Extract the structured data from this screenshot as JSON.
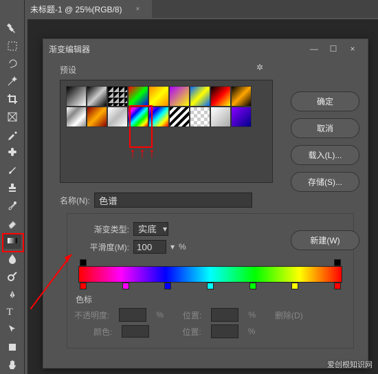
{
  "tab": {
    "title": "未标题-1 @ 25%(RGB/8)",
    "close": "×"
  },
  "dialog": {
    "title": "渐变编辑器",
    "min": "—",
    "max": "☐",
    "close": "×",
    "presets_label": "预设",
    "gear": "✲",
    "buttons": {
      "ok": "确定",
      "cancel": "取消",
      "load": "载入(L)...",
      "save": "存储(S)..."
    },
    "name_label": "名称(N):",
    "name_value": "色谱",
    "new_btn": "新建(W)",
    "type_label": "渐变类型:",
    "type_value": "实底",
    "smooth_label": "平滑度(M):",
    "smooth_value": "100",
    "percent": "%",
    "stops_title": "色标",
    "opacity_label": "不透明度:",
    "position_label": "位置:",
    "delete_label": "删除(D)",
    "color_label": "颜色:"
  },
  "watermark": "爱创根知识网"
}
